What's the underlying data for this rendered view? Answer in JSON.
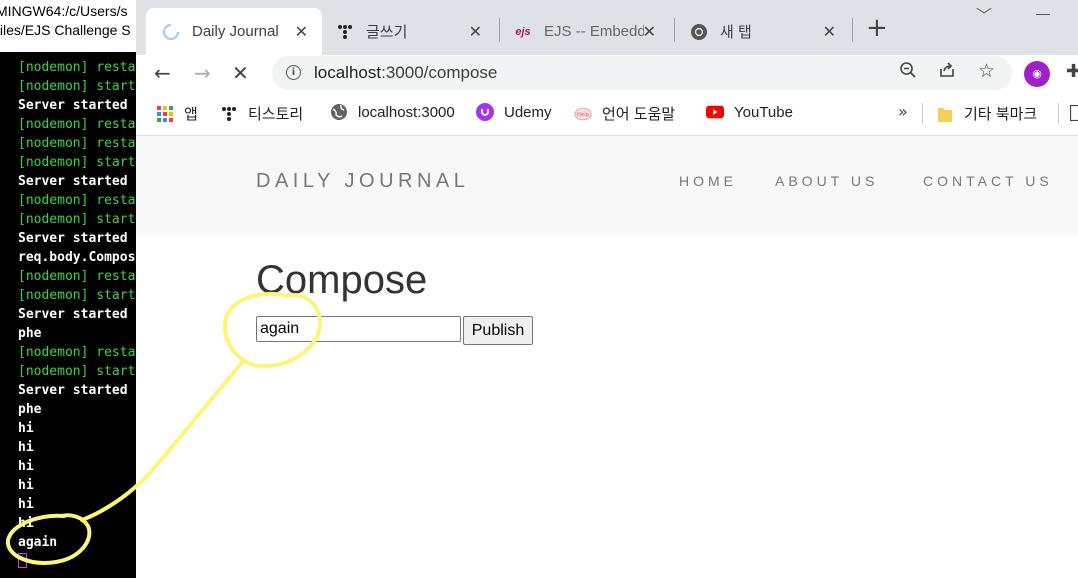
{
  "terminal": {
    "title_lines": [
      "MINGW64:/c/Users/s",
      "files/EJS Challenge S"
    ],
    "lines": [
      {
        "text": "[nodemon] resta",
        "color": "green"
      },
      {
        "text": "[nodemon] start",
        "color": "green"
      },
      {
        "text": "Server started",
        "color": "white"
      },
      {
        "text": "[nodemon] resta",
        "color": "green"
      },
      {
        "text": "[nodemon] resta",
        "color": "green"
      },
      {
        "text": "[nodemon] start",
        "color": "green"
      },
      {
        "text": "Server started",
        "color": "white"
      },
      {
        "text": "[nodemon] resta",
        "color": "green"
      },
      {
        "text": "[nodemon] start",
        "color": "green"
      },
      {
        "text": "Server started",
        "color": "white"
      },
      {
        "text": "req.body.Compos",
        "color": "white"
      },
      {
        "text": "[nodemon] resta",
        "color": "green"
      },
      {
        "text": "[nodemon] start",
        "color": "green"
      },
      {
        "text": "Server started",
        "color": "white"
      },
      {
        "text": "phe",
        "color": "white"
      },
      {
        "text": "[nodemon] resta",
        "color": "green"
      },
      {
        "text": "[nodemon] start",
        "color": "green"
      },
      {
        "text": "Server started",
        "color": "white"
      },
      {
        "text": "phe",
        "color": "white"
      },
      {
        "text": "hi",
        "color": "white"
      },
      {
        "text": "hi",
        "color": "white"
      },
      {
        "text": "hi",
        "color": "white"
      },
      {
        "text": "hi",
        "color": "white"
      },
      {
        "text": "hi",
        "color": "white"
      },
      {
        "text": "hi",
        "color": "white"
      },
      {
        "text": "again",
        "color": "white"
      }
    ]
  },
  "browser": {
    "tabs": [
      {
        "label": "Daily Journal",
        "icon": "loading-spinner-icon",
        "active": true
      },
      {
        "label": "글쓰기",
        "icon": "tistory-icon",
        "active": false
      },
      {
        "label": "EJS -- Embedd",
        "icon": "ejs-icon",
        "active": false
      },
      {
        "label": "새 탭",
        "icon": "chrome-icon",
        "active": false
      }
    ],
    "url_host": "localhost",
    "url_rest": ":3000/compose",
    "bookmarks": [
      {
        "label": "앱",
        "icon": "apps-grid-icon"
      },
      {
        "label": "티스토리",
        "icon": "tistory-icon"
      },
      {
        "label": "localhost:3000",
        "icon": "globe-icon"
      },
      {
        "label": "Udemy",
        "icon": "udemy-icon"
      },
      {
        "label": "언어 도움말",
        "icon": "help-icon"
      },
      {
        "label": "YouTube",
        "icon": "youtube-icon"
      },
      {
        "label": "기타 북마크",
        "icon": "folder-icon"
      }
    ]
  },
  "site": {
    "brand": "DAILY JOURNAL",
    "nav": [
      "HOME",
      "ABOUT US",
      "CONTACT US"
    ],
    "heading": "Compose",
    "input_value": "again",
    "publish_label": "Publish"
  },
  "colors": {
    "terminal_green": "#3ad53a",
    "annotation_yellow": "#fbf67a",
    "header_bg": "#f8f8f8"
  }
}
